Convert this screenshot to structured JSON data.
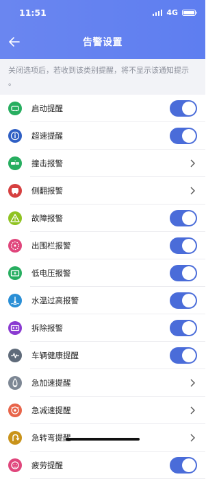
{
  "status_bar": {
    "time": "11:51",
    "network": "4G"
  },
  "header": {
    "title": "告警设置"
  },
  "notice": "关闭选项后，若收到该类别提醒，将不显示该通知提示 。",
  "items": [
    {
      "label": "启动提醒",
      "control": "toggle",
      "on": true,
      "icon": "car-start-icon",
      "color": "#27ae60"
    },
    {
      "label": "超速提醒",
      "control": "toggle",
      "on": true,
      "icon": "speed-info-icon",
      "color": "#2f5fc4"
    },
    {
      "label": "撞击报警",
      "control": "chevron",
      "icon": "crash-icon",
      "color": "#27ae60"
    },
    {
      "label": "侧翻报警",
      "control": "chevron",
      "icon": "rollover-icon",
      "color": "#d64040"
    },
    {
      "label": "故障报警",
      "control": "toggle",
      "on": true,
      "icon": "fault-warning-icon",
      "color": "#8fc321"
    },
    {
      "label": "出围栏报警",
      "control": "toggle",
      "on": true,
      "icon": "geofence-icon",
      "color": "#e0467c"
    },
    {
      "label": "低电压报警",
      "control": "toggle",
      "on": true,
      "icon": "battery-icon",
      "color": "#27ae60"
    },
    {
      "label": "水温过高报警",
      "control": "toggle",
      "on": true,
      "icon": "water-temp-icon",
      "color": "#2a8fd6"
    },
    {
      "label": "拆除报警",
      "control": "toggle",
      "on": true,
      "icon": "removal-icon",
      "color": "#8a3ad1"
    },
    {
      "label": "车辆健康提醒",
      "control": "toggle",
      "on": true,
      "icon": "health-pulse-icon",
      "color": "#5f6b7a"
    },
    {
      "label": "急加速提醒",
      "control": "chevron",
      "icon": "rapid-accel-icon",
      "color": "#7d8794"
    },
    {
      "label": "急减速提醒",
      "control": "chevron",
      "icon": "hard-brake-icon",
      "color": "#e8654a"
    },
    {
      "label": "急转弯提醒",
      "control": "chevron",
      "icon": "sharp-turn-icon",
      "color": "#c9931a"
    },
    {
      "label": "疲劳提醒",
      "control": "toggle",
      "on": true,
      "icon": "fatigue-icon",
      "color": "#e0467c"
    }
  ]
}
